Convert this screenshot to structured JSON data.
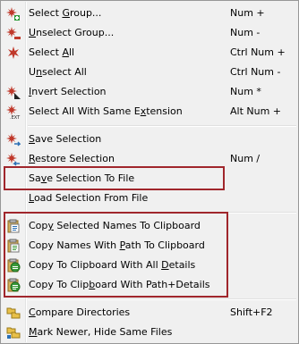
{
  "menu": {
    "items": [
      {
        "label_pre": "Select ",
        "label_u": "G",
        "label_post": "roup...",
        "shortcut": "Num +",
        "icon": "select-group-icon"
      },
      {
        "label_pre": "",
        "label_u": "U",
        "label_post": "nselect Group...",
        "shortcut": "Num -",
        "icon": "unselect-group-icon"
      },
      {
        "label_pre": "Select ",
        "label_u": "A",
        "label_post": "ll",
        "shortcut": "Ctrl Num +",
        "icon": "select-all-icon"
      },
      {
        "label_pre": "U",
        "label_u": "n",
        "label_post": "select All",
        "shortcut": "Ctrl Num -",
        "icon": ""
      },
      {
        "label_pre": "",
        "label_u": "I",
        "label_post": "nvert Selection",
        "shortcut": "Num *",
        "icon": "invert-selection-icon"
      },
      {
        "label_pre": "Select All With Same E",
        "label_u": "x",
        "label_post": "tension",
        "shortcut": "Alt Num +",
        "icon": "select-extension-icon"
      },
      {
        "label_pre": "",
        "label_u": "S",
        "label_post": "ave Selection",
        "shortcut": "",
        "icon": "save-selection-icon"
      },
      {
        "label_pre": "",
        "label_u": "R",
        "label_post": "estore Selection",
        "shortcut": "Num /",
        "icon": "restore-selection-icon"
      },
      {
        "label_pre": "Sa",
        "label_u": "v",
        "label_post": "e Selection To File",
        "shortcut": "",
        "icon": ""
      },
      {
        "label_pre": "",
        "label_u": "L",
        "label_post": "oad Selection From File",
        "shortcut": "",
        "icon": ""
      },
      {
        "label_pre": "Cop",
        "label_u": "y",
        "label_post": " Selected Names To Clipboard",
        "shortcut": "",
        "icon": "copy-names-icon"
      },
      {
        "label_pre": "Copy Names With ",
        "label_u": "P",
        "label_post": "ath To Clipboard",
        "shortcut": "",
        "icon": "copy-path-icon"
      },
      {
        "label_pre": "Copy To Clipboard With All ",
        "label_u": "D",
        "label_post": "etails",
        "shortcut": "",
        "icon": "copy-details-icon"
      },
      {
        "label_pre": "Copy To Clip",
        "label_u": "b",
        "label_post": "oard With Path+Details",
        "shortcut": "",
        "icon": "copy-path-details-icon"
      },
      {
        "label_pre": "",
        "label_u": "C",
        "label_post": "ompare Directories",
        "shortcut": "Shift+F2",
        "icon": "compare-directories-icon"
      },
      {
        "label_pre": "",
        "label_u": "M",
        "label_post": "ark Newer, Hide Same Files",
        "shortcut": "",
        "icon": "mark-newer-icon"
      }
    ]
  },
  "colors": {
    "highlight_border": "#a0262c",
    "menu_bg": "#f0f0f0"
  }
}
